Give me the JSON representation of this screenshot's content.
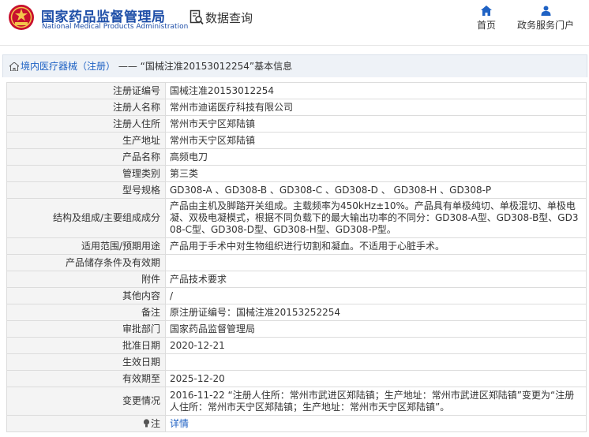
{
  "header": {
    "brand_cn": "国家药品监督管理局",
    "brand_en": "National Medical Products Administration",
    "section_title": "数据查询",
    "nav": {
      "home": "首页",
      "gov_service": "政务服务门户"
    }
  },
  "breadcrumb": {
    "category_link": "境内医疗器械（注册）",
    "separator": " —— ",
    "page_title": "“国械注准20153012254”基本信息"
  },
  "rows": [
    {
      "label": "注册证编号",
      "value": "国械注准20153012254"
    },
    {
      "label": "注册人名称",
      "value": "常州市迪诺医疗科技有限公司"
    },
    {
      "label": "注册人住所",
      "value": "常州市天宁区郑陆镇"
    },
    {
      "label": "生产地址",
      "value": "常州市天宁区郑陆镇"
    },
    {
      "label": "产品名称",
      "value": "高频电刀"
    },
    {
      "label": "管理类别",
      "value": "第三类"
    },
    {
      "label": "型号规格",
      "value": "GD308-A 、GD308-B 、GD308-C 、GD308-D 、 GD308-H 、GD308-P"
    },
    {
      "label": "结构及组成/主要组成成分",
      "value": "产品由主机及脚踏开关组成。主载频率为450kHz±10%。产品具有单极纯切、单极混切、单极电凝、双极电凝模式，根据不同负载下的最大输出功率的不同分：GD308-A型、GD308-B型、GD308-C型、GD308-D型、GD308-H型、GD308-P型。"
    },
    {
      "label": "适用范围/预期用途",
      "value": "产品用于手术中对生物组织进行切割和凝血。不适用于心脏手术。"
    },
    {
      "label": "产品储存条件及有效期",
      "value": ""
    },
    {
      "label": "附件",
      "value": "产品技术要求"
    },
    {
      "label": "其他内容",
      "value": "/"
    },
    {
      "label": "备注",
      "value": "原注册证编号：国械注准20153252254"
    },
    {
      "label": "审批部门",
      "value": "国家药品监督管理局"
    },
    {
      "label": "批准日期",
      "value": "2020-12-21"
    },
    {
      "label": "生效日期",
      "value": ""
    },
    {
      "label": "有效期至",
      "value": "2025-12-20"
    },
    {
      "label": "变更情况",
      "value": "2016-11-22 “注册人住所：常州市武进区郑陆镇；生产地址：常州市武进区郑陆镇”变更为“注册人住所：常州市天宁区郑陆镇；生产地址：常州市天宁区郑陆镇”。"
    }
  ],
  "note": {
    "label": "注",
    "link": "详情"
  },
  "colors": {
    "brand_blue": "#1f4fa8",
    "link_blue": "#1f62c4",
    "label_bg": "#f4f4f4",
    "crumb_bg": "#eef2f7"
  },
  "icons": [
    "emblem-logo",
    "search-doc-icon",
    "home-icon",
    "user-icon",
    "home-small-icon",
    "lightbulb-icon"
  ]
}
